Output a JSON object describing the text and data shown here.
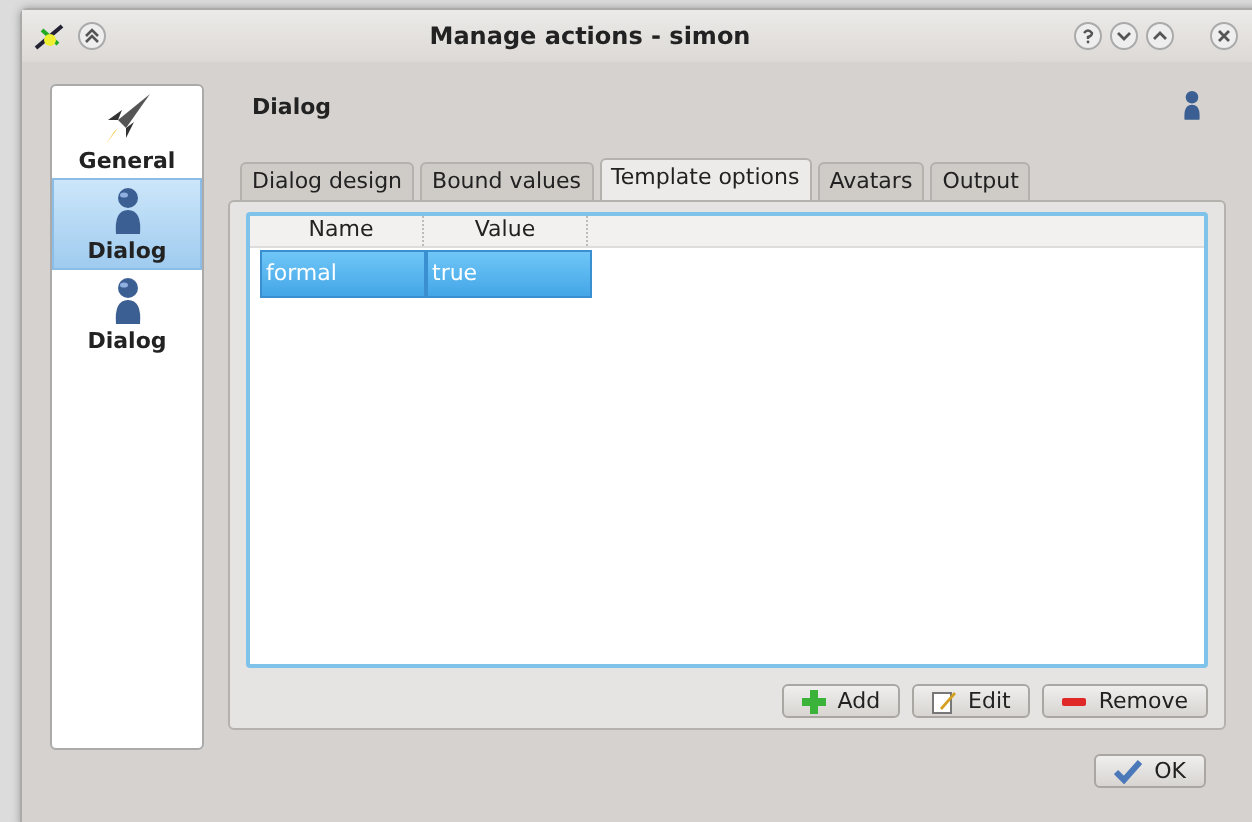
{
  "window": {
    "title": "Manage actions - simon"
  },
  "sidebar": {
    "items": [
      {
        "label": "General",
        "kind": "rocket",
        "selected": false
      },
      {
        "label": "Dialog",
        "kind": "person",
        "selected": true
      },
      {
        "label": "Dialog",
        "kind": "person",
        "selected": false
      }
    ]
  },
  "page": {
    "title": "Dialog"
  },
  "tabs": [
    {
      "label": "Dialog design",
      "selected": false
    },
    {
      "label": "Bound values",
      "selected": false
    },
    {
      "label": "Template options",
      "selected": true
    },
    {
      "label": "Avatars",
      "selected": false
    },
    {
      "label": "Output",
      "selected": false
    }
  ],
  "table": {
    "columns": [
      "Name",
      "Value"
    ],
    "rows": [
      {
        "cells": [
          "formal",
          "true"
        ],
        "selected": true
      }
    ]
  },
  "buttons": [
    {
      "label": "Add",
      "kind": "add"
    },
    {
      "label": "Edit",
      "kind": "edit"
    },
    {
      "label": "Remove",
      "kind": "remove"
    }
  ],
  "ok_button": {
    "label": "OK"
  }
}
